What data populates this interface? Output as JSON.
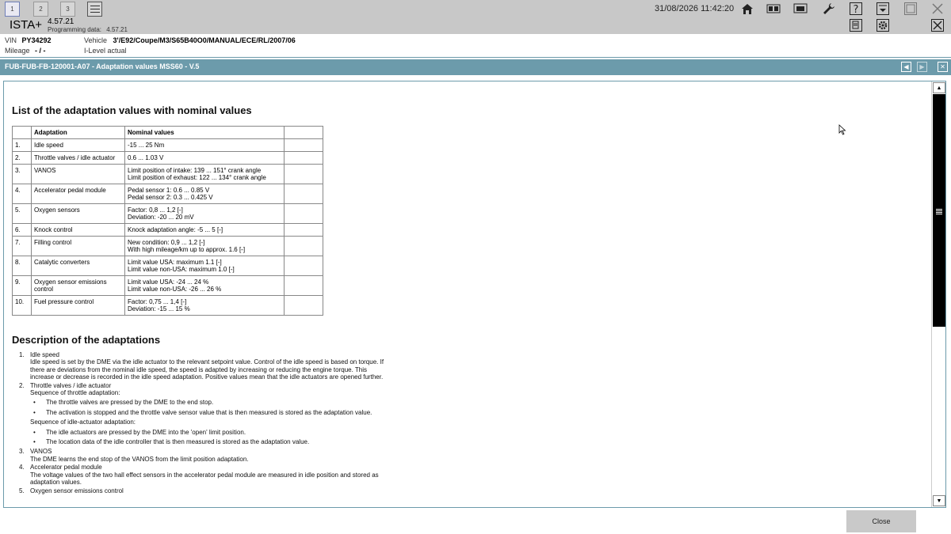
{
  "topbar": {
    "tabs": [
      "1",
      "2",
      "3"
    ],
    "datetime": "31/08/2026 11:42:20",
    "icons": [
      "home-icon",
      "vehicle-identify-icon",
      "display-icon",
      "wrench-icon",
      "help-icon",
      "minimize-icon",
      "window-icon",
      "close-icon"
    ]
  },
  "app": {
    "title": "ISTA+",
    "version": "4.57.21",
    "programming_label": "Programming data:",
    "programming_value": "4.57.21"
  },
  "vehicle": {
    "vin_label": "VIN",
    "vin": "PY34292",
    "vehicle_label": "Vehicle",
    "vehicle": "3'/E92/Coupe/M3/S65B40O0/MANUAL/ECE/RL/2007/06",
    "mileage_label": "Mileage",
    "mileage": "- / -",
    "ilevel": "I-Level actual"
  },
  "document": {
    "title": "FUB-FUB-FB-120001-A07 - Adaptation values MSS60 - V.5",
    "heading1": "List of the adaptation values with nominal values",
    "table": {
      "headers": [
        "",
        "Adaptation",
        "Nominal values",
        ""
      ],
      "rows": [
        {
          "num": "1.",
          "name": "Idle speed",
          "values": [
            "-15 ... 25 Nm"
          ]
        },
        {
          "num": "2.",
          "name": "Throttle valves / idle actuator",
          "values": [
            "0.6 ... 1.03 V"
          ]
        },
        {
          "num": "3.",
          "name": "VANOS",
          "values": [
            "Limit position of intake: 139 ... 151° crank angle",
            "Limit position of exhaust: 122 ... 134° crank angle"
          ]
        },
        {
          "num": "4.",
          "name": "Accelerator pedal module",
          "values": [
            "Pedal sensor 1: 0.6 ... 0.85 V",
            "Pedal sensor 2: 0.3 ... 0.425 V"
          ]
        },
        {
          "num": "5.",
          "name": "Oxygen sensors",
          "values": [
            "Factor: 0,8 ... 1,2 [-]",
            "Deviation: -20 ... 20 mV"
          ]
        },
        {
          "num": "6.",
          "name": "Knock control",
          "values": [
            "Knock adaptation angle: -5 ... 5 [-]"
          ]
        },
        {
          "num": "7.",
          "name": "Filling control",
          "values": [
            "New condition: 0,9 ... 1,2 [-]",
            "With high mileage/km up to approx. 1.6 [-]"
          ]
        },
        {
          "num": "8.",
          "name": "Catalytic converters",
          "values": [
            "Limit value USA: maximum 1.1 [-]",
            "Limit value non-USA: maximum 1.0 [-]"
          ]
        },
        {
          "num": "9.",
          "name": "Oxygen sensor emissions control",
          "values": [
            "Limit value USA: -24 ... 24 %",
            "Limit value non-USA: -26 ... 26 %"
          ]
        },
        {
          "num": "10.",
          "name": "Fuel pressure control",
          "values": [
            "Factor: 0,75 ... 1,4 [-]",
            "Deviation: -15 ... 15 %"
          ]
        }
      ]
    },
    "heading2": "Description of the adaptations",
    "descriptions": [
      {
        "num": "1.",
        "title": "Idle speed",
        "lines": [
          "Idle speed is set by the DME via the idle actuator to the relevant setpoint value. Control of the idle speed is based on torque. If there are deviations from the nominal idle speed, the speed is adapted by increasing or reducing the engine torque. This increase or decrease is recorded in the idle speed adaptation. Positive values mean that the idle actuators are opened further."
        ]
      },
      {
        "num": "2.",
        "title": "Throttle valves / idle actuator",
        "sub1": "Sequence of throttle adaptation:",
        "bullets1": [
          "The throttle valves are pressed by the DME to the end stop.",
          "The activation is stopped and the throttle valve sensor value that is then measured is stored as the adaptation value."
        ],
        "sub2": "Sequence of idle-actuator adaptation:",
        "bullets2": [
          "The idle actuators are pressed by the DME into the 'open' limit position.",
          "The location data of the idle controller that is then measured is stored as the adaptation value."
        ]
      },
      {
        "num": "3.",
        "title": "VANOS",
        "lines": [
          "The DME learns the end stop of the VANOS from the limit position adaptation."
        ]
      },
      {
        "num": "4.",
        "title": "Accelerator pedal module",
        "lines": [
          "The voltage values of the two hall effect sensors in the accelerator pedal module are measured in idle position and stored as adaptation values."
        ]
      },
      {
        "num": "5.",
        "title": "Oxygen sensor emissions control",
        "lines": []
      }
    ]
  },
  "footer": {
    "close_label": "Close"
  }
}
